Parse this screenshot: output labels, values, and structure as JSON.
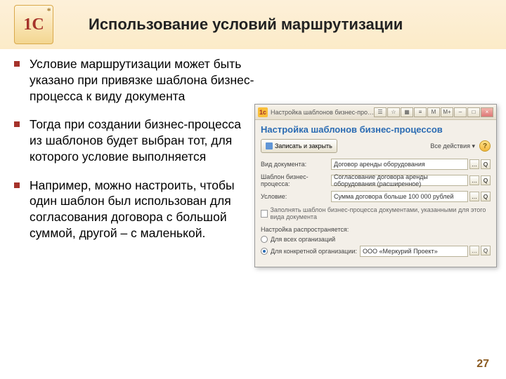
{
  "slide": {
    "title": "Использование условий маршрутизации",
    "page_number": "27",
    "bullets": [
      "Условие маршрутизации может быть указано при привязке шаблона бизнес-процесса к виду документа",
      "Тогда при создании бизнес-процесса из шаблонов будет выбран тот, для которого условие выполняется",
      "Например, можно настроить, чтобы один шаблон был использован для согласования договора с большой суммой, другой – с маленькой."
    ]
  },
  "window": {
    "titlebar": "Настройка шаблонов бизнес-про… (1С:Предприятие)",
    "heading": "Настройка шаблонов бизнес-процессов",
    "save_btn": "Записать и закрыть",
    "all_actions": "Все действия ▾",
    "rows": {
      "r1_label": "Вид документа:",
      "r1_value": "Договор аренды оборудования",
      "r2_label": "Шаблон бизнес-процесса:",
      "r2_value": "Согласование договора аренды оборудования (расширенное)",
      "r3_label": "Условие:",
      "r3_value": "Сумма договора больше 100 000 рублей"
    },
    "checkbox_label": "Заполнять шаблон бизнес-процесса документами, указанными для этого вида документа",
    "section": "Настройка распространяется:",
    "radio1": "Для всех организаций",
    "radio2": "Для конкретной организации:",
    "org_value": "ООО «Меркурий Проект»"
  },
  "logo": "1C"
}
